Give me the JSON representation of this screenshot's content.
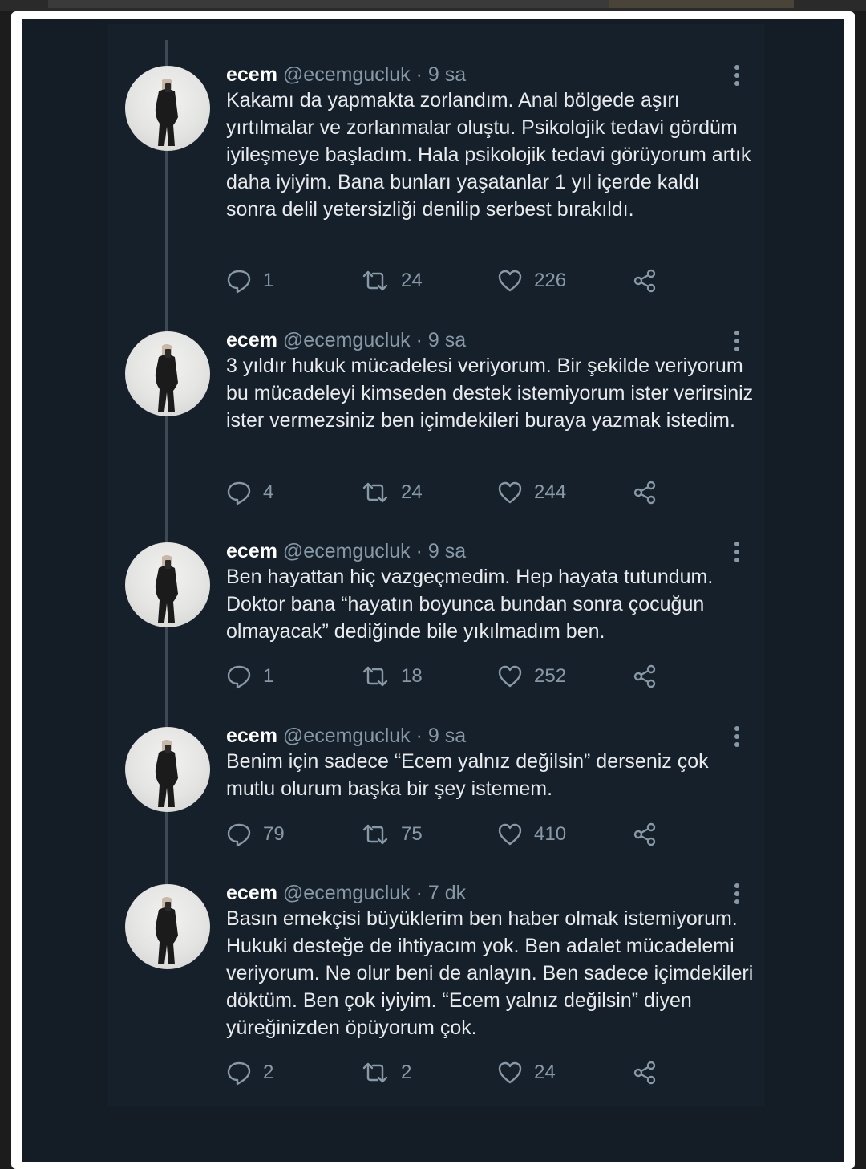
{
  "tweets": [
    {
      "name": "ecem",
      "handle": "@ecemgucluk",
      "dot": "·",
      "time": "9 sa",
      "text": "Kakamı da yapmakta zorlandım. Anal bölgede aşırı yırtılmalar ve zorlanmalar oluştu. Psikolojik tedavi gördüm iyileşmeye başladım. Hala psikolojik tedavi görüyorum artık daha iyiyim. Bana bunları yaşatanlar 1 yıl içerde kaldı sonra delil yetersizliği denilip serbest bırakıldı.",
      "replies": "1",
      "retweets": "24",
      "likes": "226"
    },
    {
      "name": "ecem",
      "handle": "@ecemgucluk",
      "dot": "·",
      "time": "9 sa",
      "text": "3 yıldır hukuk mücadelesi veriyorum. Bir şekilde veriyorum bu mücadeleyi kimseden destek istemiyorum ister verirsiniz ister vermezsiniz ben içimdekileri buraya yazmak istedim.",
      "replies": "4",
      "retweets": "24",
      "likes": "244"
    },
    {
      "name": "ecem",
      "handle": "@ecemgucluk",
      "dot": "·",
      "time": "9 sa",
      "text": "Ben hayattan hiç vazgeçmedim. Hep hayata tutundum. Doktor bana “hayatın boyunca bundan sonra çocuğun olmayacak” dediğinde bile yıkılmadım ben.",
      "replies": "1",
      "retweets": "18",
      "likes": "252"
    },
    {
      "name": "ecem",
      "handle": "@ecemgucluk",
      "dot": "·",
      "time": "9 sa",
      "text": "Benim için sadece “Ecem yalnız değilsin” derseniz çok mutlu olurum başka bir şey istemem.",
      "replies": "79",
      "retweets": "75",
      "likes": "410"
    },
    {
      "name": "ecem",
      "handle": "@ecemgucluk",
      "dot": "·",
      "time": "7 dk",
      "text": "Basın emekçisi büyüklerim ben haber olmak istemiyorum. Hukuki desteğe de ihtiyacım yok. Ben adalet mücadelemi veriyorum. Ne olur beni de anlayın. Ben sadece içimdekileri döktüm. Ben çok iyiyim. “Ecem yalnız değilsin” diyen yüreğinizden öpüyorum çok.",
      "replies": "2",
      "retweets": "2",
      "likes": "24"
    }
  ],
  "icons": {
    "reply": "reply-icon",
    "retweet": "retweet-icon",
    "like": "heart-icon",
    "share": "share-icon",
    "more": "more-options-icon"
  },
  "colors": {
    "background": "#15202b",
    "text": "#e8eaec",
    "secondary": "#8899a6"
  }
}
